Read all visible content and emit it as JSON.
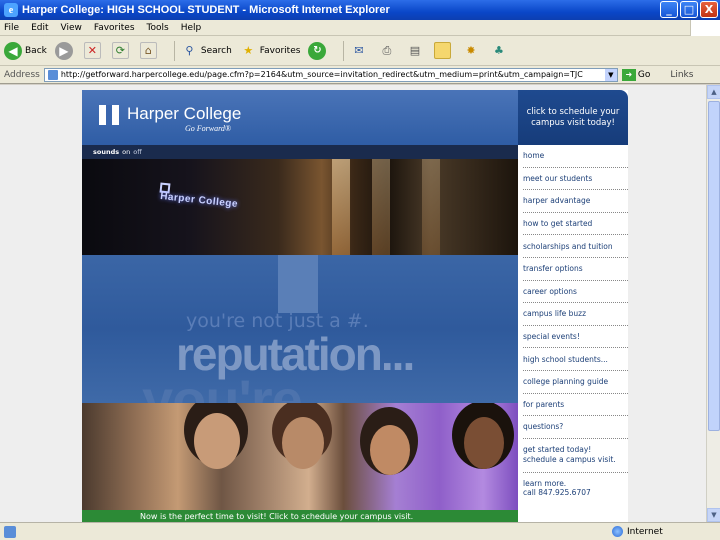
{
  "window": {
    "title": "Harper College: HIGH SCHOOL STUDENT - Microsoft Internet Explorer",
    "icon": "ie-icon",
    "buttons": [
      "_",
      "□",
      "X"
    ]
  },
  "menubar": {
    "items": [
      "File",
      "Edit",
      "View",
      "Favorites",
      "Tools",
      "Help"
    ]
  },
  "toolbar": {
    "back_label": "Back",
    "search_label": "Search",
    "favorites_label": "Favorites"
  },
  "address": {
    "label": "Address",
    "url": "http://getforward.harpercollege.edu/page.cfm?p=2164&utm_source=invitation_redirect&utm_medium=print&utm_campaign=TJC",
    "go_label": "Go",
    "links_label": "Links"
  },
  "page": {
    "logo": {
      "name": "Harper College",
      "tagline": "Go Forward®"
    },
    "cta": "click to schedule your campus visit today!",
    "sound": {
      "label": "sounds",
      "on": "on",
      "off": "off"
    },
    "hero_sign": "Harper College",
    "tagline_small": "you're not just a #.",
    "tagline_big": "reputation...",
    "ghost_text": "you're",
    "green_bar": "Now is the perfect time to visit! Click to schedule your campus visit.",
    "nav": [
      "home",
      "meet our students",
      "harper advantage",
      "how to get started",
      "scholarships and tuition",
      "transfer options",
      "career options",
      "campus life buzz",
      "special events!",
      "high school students...",
      "college planning guide",
      "for parents",
      "questions?"
    ],
    "nav_multi": [
      "get started today!",
      "schedule a campus visit."
    ],
    "contact": [
      "learn more.",
      "call 847.925.6707"
    ]
  },
  "statusbar": {
    "zone": "Internet"
  },
  "colors": {
    "header_blue": "#3a66ae",
    "nav_text": "#1c3f77",
    "green_bar": "#2c8a36"
  }
}
